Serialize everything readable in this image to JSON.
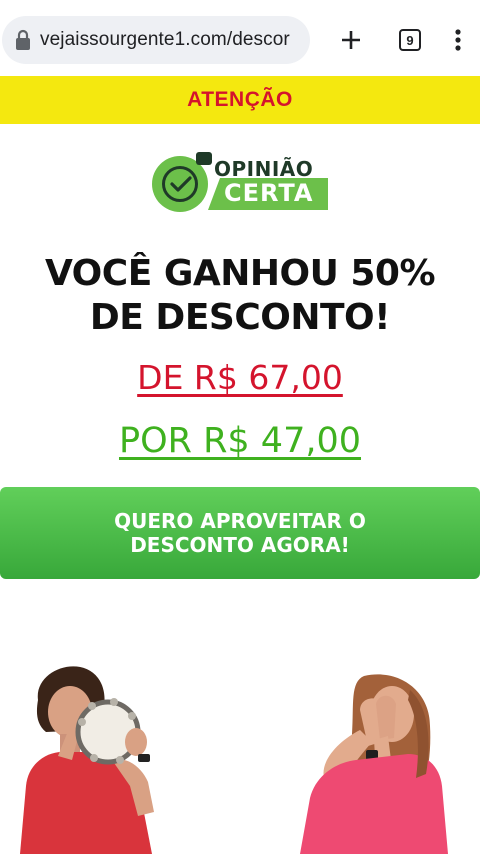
{
  "browser": {
    "url": "vejaissourgente1.com/descor",
    "tab_count": "9",
    "icons": [
      "lock-icon",
      "new-tab-icon",
      "tab-switcher-icon",
      "menu-icon"
    ]
  },
  "banner": {
    "text": "ATENÇÃO"
  },
  "logo": {
    "line1": "OPINIÃO",
    "line2": "CERTA"
  },
  "headline": {
    "line1": "VOCÊ GANHOU 50%",
    "line2": "DE DESCONTO!"
  },
  "pricing": {
    "old_price": "DE R$ 67,00",
    "new_price": "POR R$ 47,00"
  },
  "cta": {
    "label": "QUERO APROVEITAR O DESCONTO AGORA!"
  },
  "colors": {
    "banner_bg": "#f4e80f",
    "alert_red": "#d4142d",
    "brand_green": "#6cc04a",
    "cta_green": "#4cbf48"
  }
}
